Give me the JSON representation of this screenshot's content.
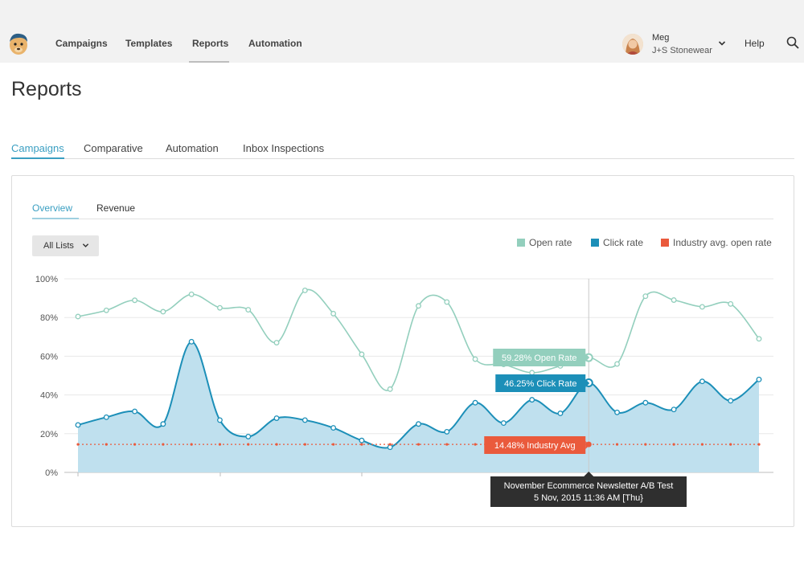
{
  "nav": {
    "items": [
      "Campaigns",
      "Templates",
      "Reports",
      "Automation"
    ],
    "active": "Reports"
  },
  "user": {
    "name": "Meg",
    "org": "J+S Stonewear"
  },
  "help_label": "Help",
  "page_title": "Reports",
  "tabs": [
    "Campaigns",
    "Comparative",
    "Automation",
    "Inbox Inspections"
  ],
  "active_tab": "Campaigns",
  "subtabs": [
    "Overview",
    "Revenue"
  ],
  "active_subtab": "Overview",
  "list_filter": {
    "selected": "All Lists"
  },
  "colors": {
    "accent": "#3a9fc2",
    "open_rate": "#93cfbd",
    "click_rate": "#1c8fb8",
    "industry": "#ea5a3c"
  },
  "icons": [
    "mailchimp-logo-icon",
    "chevron-down-icon",
    "search-icon"
  ],
  "chart_data": {
    "type": "area",
    "ylim": [
      0,
      100
    ],
    "yticks": [
      "0%",
      "20%",
      "40%",
      "60%",
      "80%",
      "100%"
    ],
    "series": [
      {
        "name": "Open rate",
        "values": [
          80.5,
          83.7,
          88.9,
          83.0,
          92.0,
          85.0,
          84.0,
          67.0,
          94.0,
          82.0,
          61.0,
          43.0,
          86.0,
          88.0,
          58.5,
          55.8,
          51.5,
          55.0,
          59.28,
          56.0,
          91.0,
          89.0,
          85.5,
          87.0,
          69.0
        ]
      },
      {
        "name": "Click rate",
        "values": [
          24.5,
          28.5,
          31.5,
          25.0,
          67.5,
          27.0,
          18.5,
          28.0,
          27.0,
          23.0,
          16.5,
          13.0,
          25.0,
          21.0,
          36.0,
          25.5,
          37.5,
          30.5,
          46.25,
          31.0,
          36.0,
          32.5,
          47.0,
          37.0,
          48.0
        ]
      },
      {
        "name": "Industry avg. open rate",
        "values": [
          14.48,
          14.48,
          14.48,
          14.48,
          14.48,
          14.48,
          14.48,
          14.48,
          14.48,
          14.48,
          14.48,
          14.48,
          14.48,
          14.48,
          14.48,
          14.48,
          14.48,
          14.48,
          14.48,
          14.48,
          14.48,
          14.48,
          14.48,
          14.48,
          14.48
        ]
      }
    ],
    "highlight_index": 18,
    "tooltips": {
      "open": "59.28% Open Rate",
      "click": "46.25% Click Rate",
      "industry": "14.48% Industry Avg",
      "campaign_title": "November Ecommerce Newsletter A/B Test",
      "campaign_date": "5 Nov, 2015 11:36 AM [Thu}"
    }
  }
}
